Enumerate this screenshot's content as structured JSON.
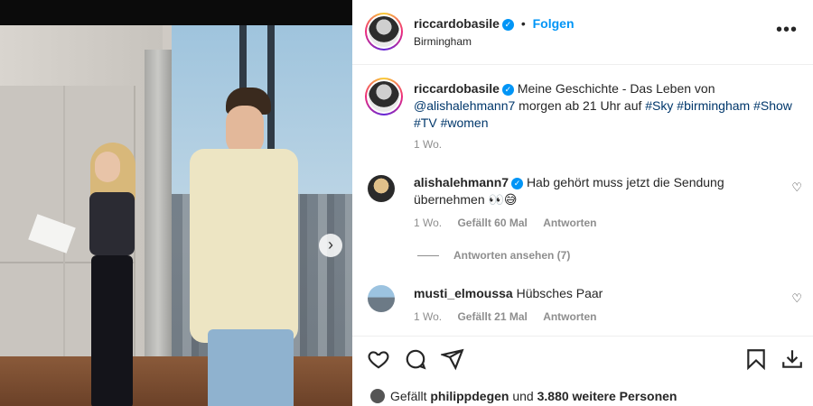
{
  "post": {
    "author": "riccardobasile",
    "follow_label": "Folgen",
    "location": "Birmingham",
    "more_icon": "more-horizontal-icon",
    "caption": {
      "author": "riccardobasile",
      "text_1": "Meine Geschichte - Das Leben von",
      "mention": "@alishalehmann7",
      "text_2": "morgen ab 21 Uhr auf",
      "hashtags": [
        "#Sky",
        "#birmingham",
        "#Show",
        "#TV",
        "#women"
      ],
      "time": "1 Wo."
    },
    "comments": [
      {
        "author": "alishalehmann7",
        "text": "Hab gehört muss jetzt die Sendung übernehmen 👀😅",
        "time": "1 Wo.",
        "likes": "Gefällt 60 Mal",
        "reply": "Antworten",
        "view_replies": "Antworten ansehen (7)"
      },
      {
        "author": "musti_elmoussa",
        "text": "Hübsches Paar",
        "time": "1 Wo.",
        "likes": "Gefällt 21 Mal",
        "reply": "Antworten"
      }
    ],
    "liked_by": {
      "prefix": "Gefällt",
      "user": "philippdegen",
      "connector": "und",
      "others": "3.880 weitere Personen"
    }
  },
  "colors": {
    "accent_blue": "#0095f6",
    "link_blue": "#00376b",
    "muted": "#8e8e8e",
    "text": "#262626"
  }
}
